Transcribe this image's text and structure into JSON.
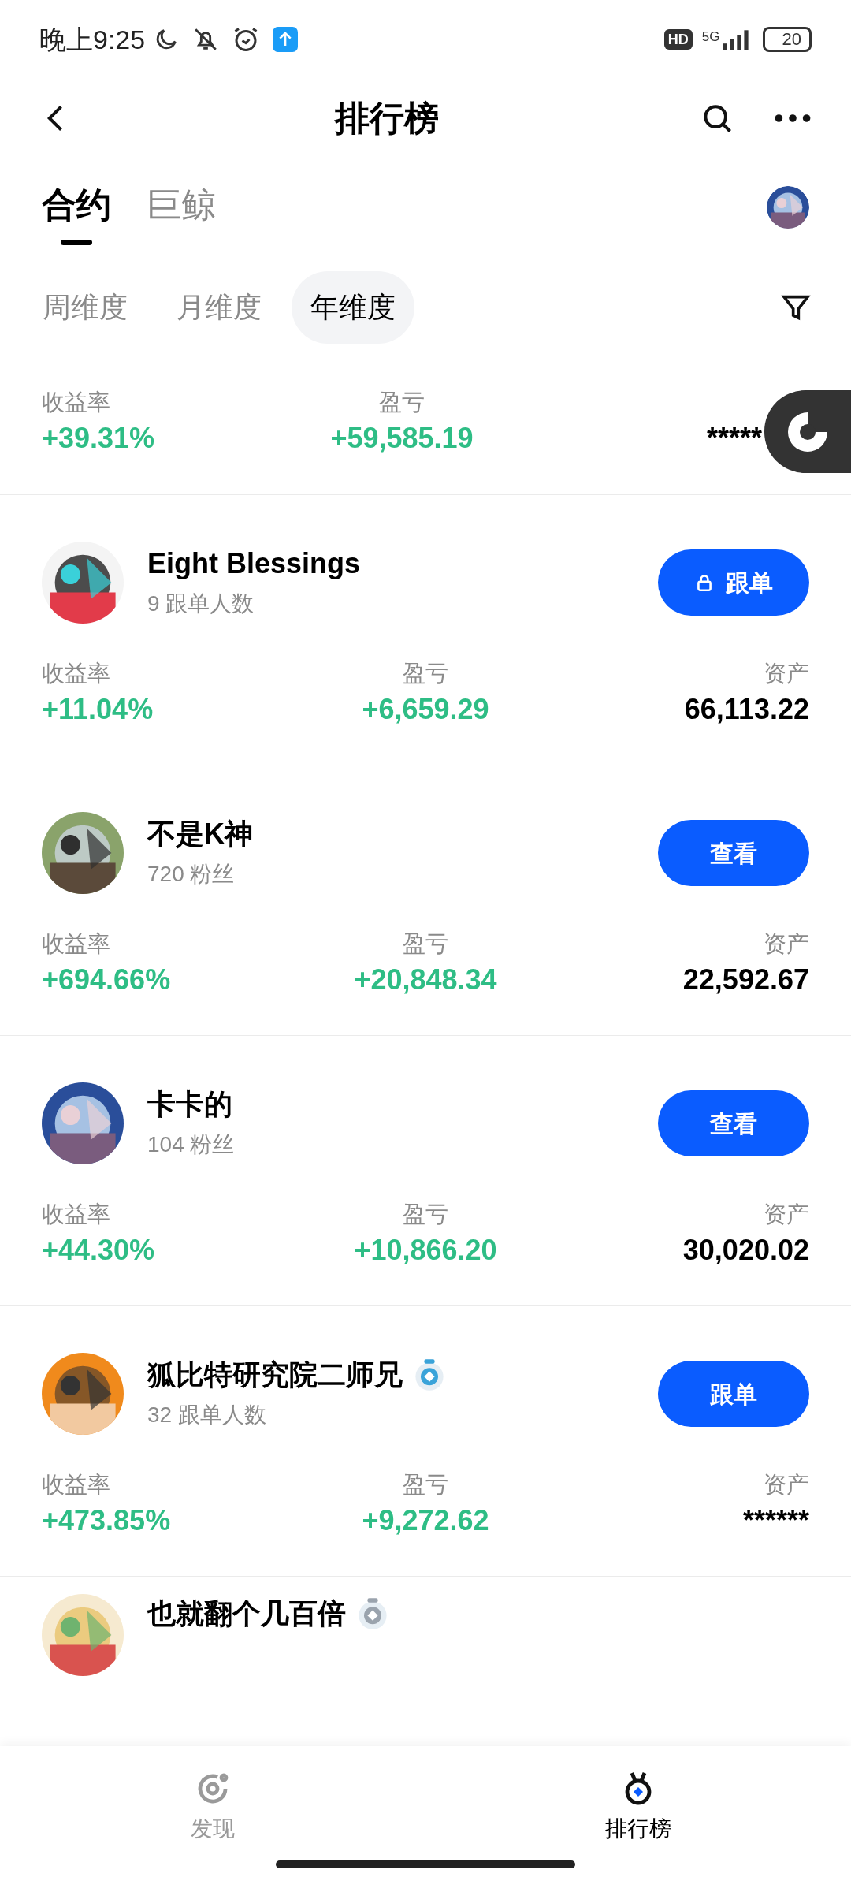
{
  "status_bar": {
    "time": "晚上9:25",
    "hd": "HD",
    "network": "5G",
    "battery": "20"
  },
  "header": {
    "title": "排行榜"
  },
  "tabs": [
    {
      "label": "合约",
      "selected": true
    },
    {
      "label": "巨鲸",
      "selected": false
    }
  ],
  "periods": [
    {
      "label": "周维度",
      "selected": false
    },
    {
      "label": "月维度",
      "selected": false
    },
    {
      "label": "年维度",
      "selected": true
    }
  ],
  "traders": [
    {
      "kind": "partial",
      "stats": [
        {
          "label": "收益率",
          "value": "+39.31%",
          "kind": "gain"
        },
        {
          "label": "盈亏",
          "value": "+59,585.19",
          "kind": "gain"
        },
        {
          "value": "*****",
          "kind": "plain"
        }
      ]
    },
    {
      "kind": "full",
      "name": "Eight Blessings",
      "sub": "9 跟单人数",
      "button": {
        "label": "跟单",
        "locked": true
      },
      "stats": [
        {
          "label": "收益率",
          "value": "+11.04%",
          "kind": "gain"
        },
        {
          "label": "盈亏",
          "value": "+6,659.29",
          "kind": "gain"
        },
        {
          "label": "资产",
          "value": "66,113.22",
          "kind": "plain"
        }
      ]
    },
    {
      "kind": "full",
      "name": "不是K神",
      "sub": "720 粉丝",
      "button": {
        "label": "查看",
        "locked": false
      },
      "stats": [
        {
          "label": "收益率",
          "value": "+694.66%",
          "kind": "gain"
        },
        {
          "label": "盈亏",
          "value": "+20,848.34",
          "kind": "gain"
        },
        {
          "label": "资产",
          "value": "22,592.67",
          "kind": "plain"
        }
      ]
    },
    {
      "kind": "full",
      "name": "卡卡的",
      "sub": "104 粉丝",
      "button": {
        "label": "查看",
        "locked": false
      },
      "stats": [
        {
          "label": "收益率",
          "value": "+44.30%",
          "kind": "gain"
        },
        {
          "label": "盈亏",
          "value": "+10,866.20",
          "kind": "gain"
        },
        {
          "label": "资产",
          "value": "30,020.02",
          "kind": "plain"
        }
      ]
    },
    {
      "kind": "full",
      "name": "狐比特研究院二师兄",
      "sub": "32 跟单人数",
      "color": "#3aa3d9",
      "button": {
        "label": "跟单",
        "locked": false
      },
      "stats": [
        {
          "label": "收益率",
          "value": "+473.85%",
          "kind": "gain"
        },
        {
          "label": "盈亏",
          "value": "+9,272.62",
          "kind": "gain"
        },
        {
          "label": "资产",
          "value": "******",
          "kind": "plain"
        }
      ]
    },
    {
      "kind": "full",
      "name": "也就翻个几百倍",
      "color": "#9aa3ad"
    }
  ],
  "nav": [
    {
      "label": "发现",
      "selected": false,
      "kind": "discover"
    },
    {
      "label": "排行榜",
      "selected": true,
      "kind": "ranking"
    }
  ]
}
